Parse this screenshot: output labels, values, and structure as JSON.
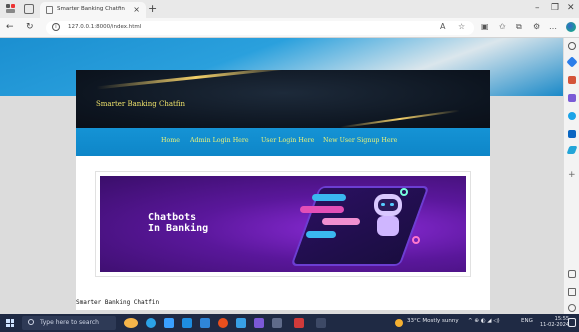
{
  "browser": {
    "tab_title": "Smarter Banking Chatfin",
    "new_tab_symbol": "+",
    "close_tab_symbol": "×",
    "url": "127.0.0.1:8000/index.html",
    "window_controls": {
      "minimize": "–",
      "restore": "❐",
      "close": "✕"
    }
  },
  "site": {
    "brand": "Smarter Banking Chatfin",
    "menu": [
      {
        "label": "Home"
      },
      {
        "label": "Admin Login Here"
      },
      {
        "label": "User Login Here"
      },
      {
        "label": "New User Signup Here"
      }
    ],
    "hero_text_line1": "Chatbots",
    "hero_text_line2": "In Banking",
    "footer": "Smarter Banking Chatfin"
  },
  "taskbar": {
    "search_placeholder": "Type here to search",
    "weather": "33°C  Mostly sunny",
    "language": "ENG",
    "time": "15:55",
    "date": "11-02-2024"
  },
  "colors": {
    "menu_link": "#e8f27a",
    "menu_bg": "#1593d5",
    "brand_text": "#f0e36b",
    "hero_purple": "#5a179b"
  }
}
